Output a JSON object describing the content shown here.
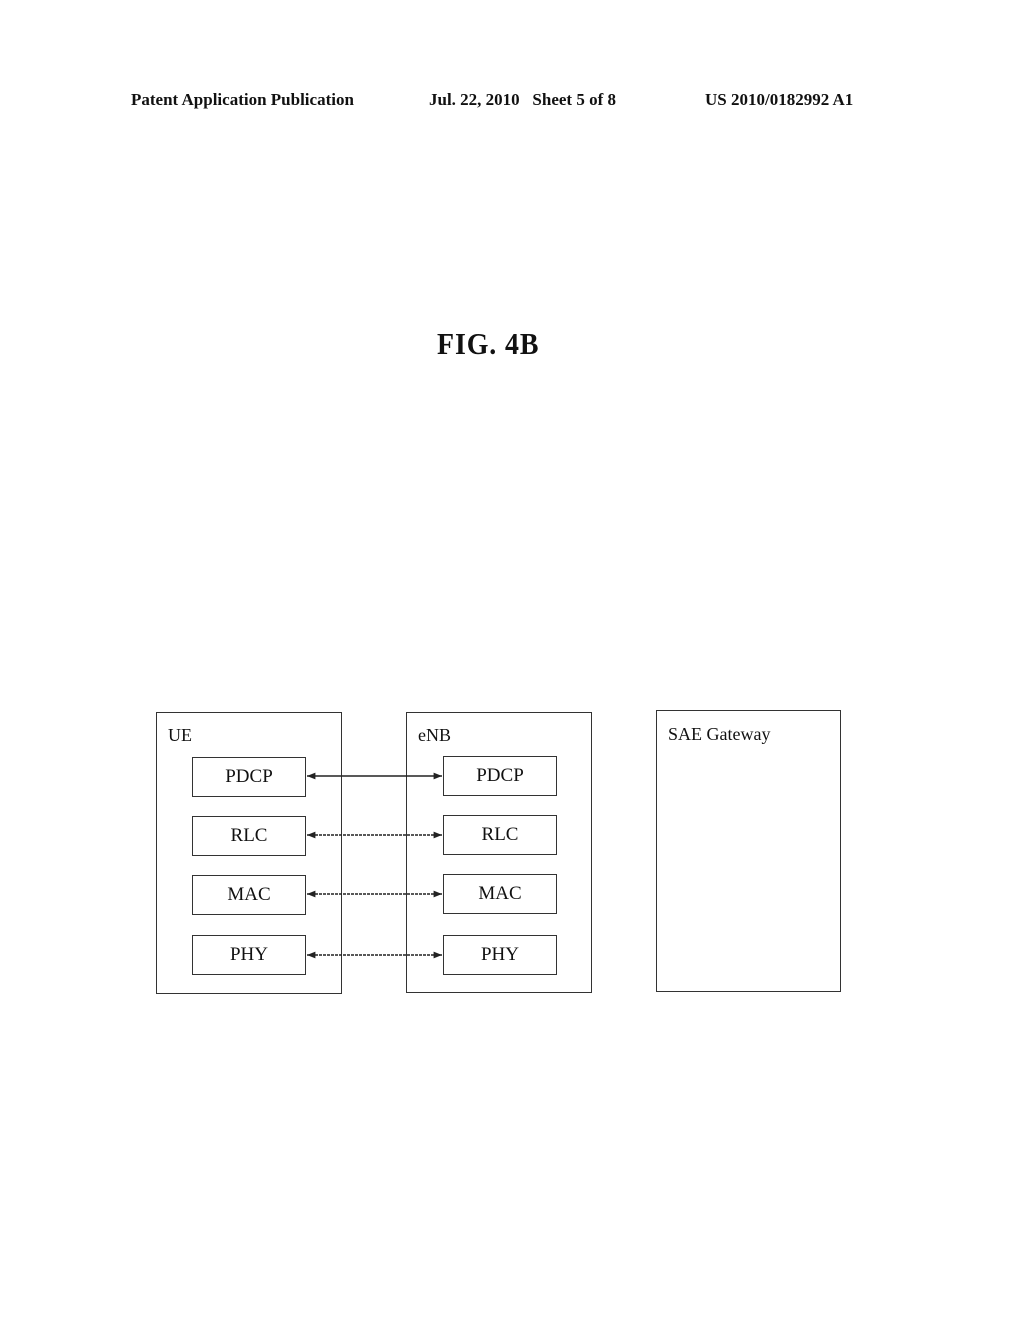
{
  "header": {
    "publication": "Patent Application Publication",
    "date_sheet": "Jul. 22, 2010   Sheet 5 of 8",
    "number": "US 2010/0182992 A1"
  },
  "figure": {
    "title": "FIG. 4B",
    "nodes": [
      {
        "id": "ue",
        "label": "UE",
        "layers": [
          "PDCP",
          "RLC",
          "MAC",
          "PHY"
        ]
      },
      {
        "id": "enb",
        "label": "eNB",
        "layers": [
          "PDCP",
          "RLC",
          "MAC",
          "PHY"
        ]
      },
      {
        "id": "sae",
        "label": "SAE Gateway",
        "layers": []
      }
    ],
    "connections": [
      {
        "from": "ue.PDCP",
        "to": "enb.PDCP",
        "type": "bidirectional"
      },
      {
        "from": "ue.RLC",
        "to": "enb.RLC",
        "type": "bidirectional"
      },
      {
        "from": "ue.MAC",
        "to": "enb.MAC",
        "type": "bidirectional"
      },
      {
        "from": "ue.PHY",
        "to": "enb.PHY",
        "type": "bidirectional"
      }
    ]
  }
}
